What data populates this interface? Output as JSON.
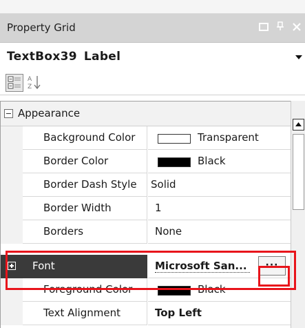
{
  "panel": {
    "title": "Property Grid",
    "window_buttons": [
      "▭",
      "ᵱ",
      "✕"
    ]
  },
  "object": {
    "name": "TextBox39",
    "type": "Label"
  },
  "category": {
    "label": "Appearance"
  },
  "properties": [
    {
      "name": "Background Color",
      "value": "Transparent",
      "swatch": "#ffffff"
    },
    {
      "name": "Border Color",
      "value": "Black",
      "swatch": "#000000"
    },
    {
      "name": "Border Dash Style",
      "value": "Solid"
    },
    {
      "name": "Border Width",
      "value": "1"
    },
    {
      "name": "Borders",
      "value": "None"
    },
    {
      "name": "Font",
      "value": "Microsoft San...",
      "button": "···"
    },
    {
      "name": "Foreground Color",
      "value": "Black",
      "swatch": "#000000"
    },
    {
      "name": "Text Alignment",
      "value": "Top Left"
    }
  ],
  "colors": {
    "highlight": "#e8141b",
    "title_bar": "#d4d4d4",
    "selected_row": "#3a3a3a"
  }
}
